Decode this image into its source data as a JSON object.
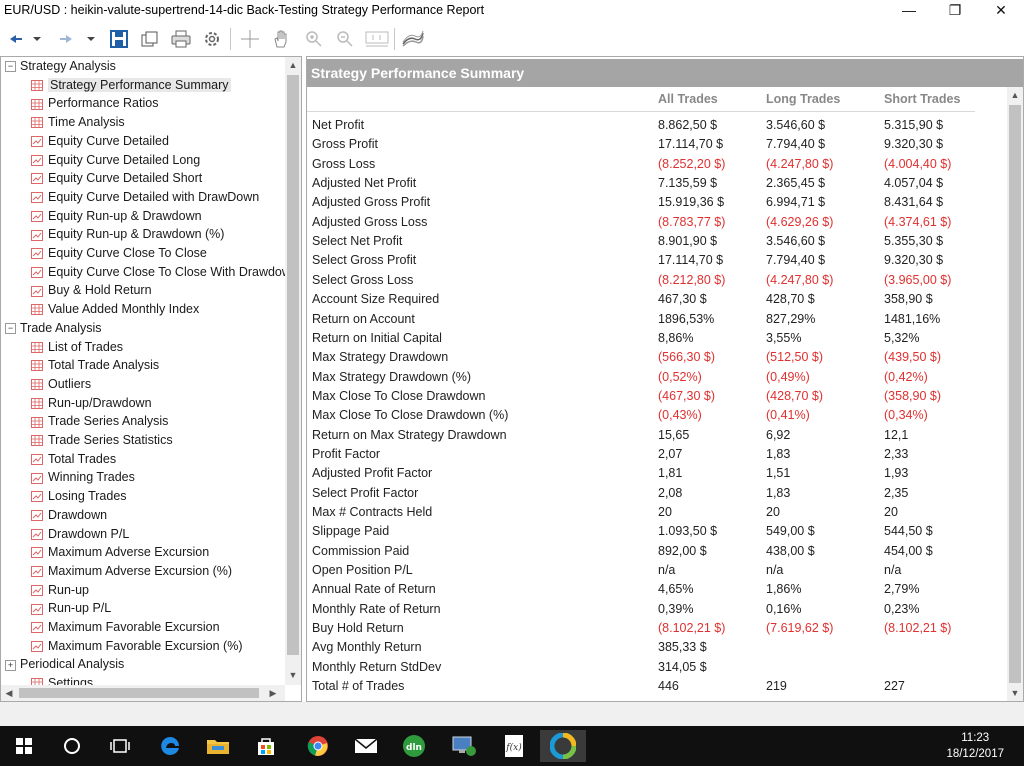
{
  "window": {
    "title": "EUR/USD : heikin-valute-supertrend-14-dic Back-Testing Strategy Performance Report",
    "minimize": "—",
    "restore": "❐",
    "close": "✕"
  },
  "toolbar": {
    "buttons": [
      "back-icon",
      "forward-icon",
      "save-icon",
      "copy-icon",
      "print-icon",
      "settings-icon",
      "crosshair-icon",
      "hand-icon",
      "zoom-in-icon",
      "zoom-out-icon",
      "zoom-fit-icon",
      "chart-style-icon"
    ]
  },
  "tree": {
    "groups": [
      {
        "label": "Strategy Analysis",
        "expanded": true,
        "items": [
          {
            "label": "Strategy Performance Summary",
            "icon": "table",
            "selected": true
          },
          {
            "label": "Performance Ratios",
            "icon": "table"
          },
          {
            "label": "Time Analysis",
            "icon": "table"
          },
          {
            "label": "Equity Curve Detailed",
            "icon": "chart"
          },
          {
            "label": "Equity Curve Detailed Long",
            "icon": "chart"
          },
          {
            "label": "Equity Curve Detailed Short",
            "icon": "chart"
          },
          {
            "label": "Equity Curve Detailed with DrawDown",
            "icon": "chart"
          },
          {
            "label": "Equity Run-up & Drawdown",
            "icon": "chart"
          },
          {
            "label": "Equity Run-up & Drawdown (%)",
            "icon": "chart"
          },
          {
            "label": "Equity Curve Close To Close",
            "icon": "chart"
          },
          {
            "label": "Equity Curve Close To Close With Drawdown",
            "icon": "chart"
          },
          {
            "label": "Buy & Hold Return",
            "icon": "chart"
          },
          {
            "label": "Value Added Monthly Index",
            "icon": "table"
          }
        ]
      },
      {
        "label": "Trade Analysis",
        "expanded": true,
        "items": [
          {
            "label": "List of Trades",
            "icon": "table"
          },
          {
            "label": "Total Trade Analysis",
            "icon": "table"
          },
          {
            "label": "Outliers",
            "icon": "table"
          },
          {
            "label": "Run-up/Drawdown",
            "icon": "table"
          },
          {
            "label": "Trade Series Analysis",
            "icon": "table"
          },
          {
            "label": "Trade Series Statistics",
            "icon": "table"
          },
          {
            "label": "Total Trades",
            "icon": "chart"
          },
          {
            "label": "Winning Trades",
            "icon": "chart"
          },
          {
            "label": "Losing Trades",
            "icon": "chart"
          },
          {
            "label": "Drawdown",
            "icon": "chart"
          },
          {
            "label": "Drawdown P/L",
            "icon": "chart"
          },
          {
            "label": "Maximum Adverse Excursion",
            "icon": "chart"
          },
          {
            "label": "Maximum Adverse Excursion (%)",
            "icon": "chart"
          },
          {
            "label": "Run-up",
            "icon": "chart"
          },
          {
            "label": "Run-up P/L",
            "icon": "chart"
          },
          {
            "label": "Maximum Favorable Excursion",
            "icon": "chart"
          },
          {
            "label": "Maximum Favorable Excursion (%)",
            "icon": "chart"
          }
        ]
      },
      {
        "label": "Periodical Analysis",
        "expanded": false,
        "items": []
      }
    ],
    "partial_item": "Settings"
  },
  "report": {
    "header": "Strategy Performance Summary",
    "columns": [
      "All Trades",
      "Long Trades",
      "Short Trades"
    ],
    "rows": [
      {
        "label": "Net Profit",
        "all": "8.862,50 $",
        "long": "3.546,60 $",
        "short": "5.315,90 $",
        "neg": false
      },
      {
        "label": "Gross Profit",
        "all": "17.114,70 $",
        "long": "7.794,40 $",
        "short": "9.320,30 $",
        "neg": false
      },
      {
        "label": "Gross Loss",
        "all": "(8.252,20 $)",
        "long": "(4.247,80 $)",
        "short": "(4.004,40 $)",
        "neg": true
      },
      {
        "label": "Adjusted Net Profit",
        "all": "7.135,59 $",
        "long": "2.365,45 $",
        "short": "4.057,04 $",
        "neg": false
      },
      {
        "label": "Adjusted Gross Profit",
        "all": "15.919,36 $",
        "long": "6.994,71 $",
        "short": "8.431,64 $",
        "neg": false
      },
      {
        "label": "Adjusted Gross Loss",
        "all": "(8.783,77 $)",
        "long": "(4.629,26 $)",
        "short": "(4.374,61 $)",
        "neg": true
      },
      {
        "label": "Select Net Profit",
        "all": "8.901,90 $",
        "long": "3.546,60 $",
        "short": "5.355,30 $",
        "neg": false
      },
      {
        "label": "Select Gross Profit",
        "all": "17.114,70 $",
        "long": "7.794,40 $",
        "short": "9.320,30 $",
        "neg": false
      },
      {
        "label": "Select Gross Loss",
        "all": "(8.212,80 $)",
        "long": "(4.247,80 $)",
        "short": "(3.965,00 $)",
        "neg": true
      },
      {
        "label": "Account Size Required",
        "all": "467,30 $",
        "long": "428,70 $",
        "short": "358,90 $",
        "neg": false
      },
      {
        "label": "Return on Account",
        "all": "1896,53%",
        "long": "827,29%",
        "short": "1481,16%",
        "neg": false
      },
      {
        "label": "Return on Initial Capital",
        "all": "8,86%",
        "long": "3,55%",
        "short": "5,32%",
        "neg": false
      },
      {
        "label": "Max Strategy Drawdown",
        "all": "(566,30 $)",
        "long": "(512,50 $)",
        "short": "(439,50 $)",
        "neg": true
      },
      {
        "label": "Max Strategy Drawdown (%)",
        "all": "(0,52%)",
        "long": "(0,49%)",
        "short": "(0,42%)",
        "neg": true
      },
      {
        "label": "Max Close To Close Drawdown",
        "all": "(467,30 $)",
        "long": "(428,70 $)",
        "short": "(358,90 $)",
        "neg": true
      },
      {
        "label": "Max Close To Close Drawdown (%)",
        "all": "(0,43%)",
        "long": "(0,41%)",
        "short": "(0,34%)",
        "neg": true
      },
      {
        "label": "Return on Max Strategy Drawdown",
        "all": "15,65",
        "long": "6,92",
        "short": "12,1",
        "neg": false
      },
      {
        "label": "Profit Factor",
        "all": "2,07",
        "long": "1,83",
        "short": "2,33",
        "neg": false
      },
      {
        "label": "Adjusted Profit Factor",
        "all": "1,81",
        "long": "1,51",
        "short": "1,93",
        "neg": false
      },
      {
        "label": "Select Profit Factor",
        "all": "2,08",
        "long": "1,83",
        "short": "2,35",
        "neg": false
      },
      {
        "label": "Max # Contracts Held",
        "all": "20",
        "long": "20",
        "short": "20",
        "neg": false
      },
      {
        "label": "Slippage Paid",
        "all": "1.093,50 $",
        "long": "549,00 $",
        "short": "544,50 $",
        "neg": false
      },
      {
        "label": "Commission Paid",
        "all": "892,00 $",
        "long": "438,00 $",
        "short": "454,00 $",
        "neg": false
      },
      {
        "label": "Open Position P/L",
        "all": "n/a",
        "long": "n/a",
        "short": "n/a",
        "neg": false
      },
      {
        "label": "Annual Rate of Return",
        "all": "4,65%",
        "long": "1,86%",
        "short": "2,79%",
        "neg": false
      },
      {
        "label": "Monthly Rate of Return",
        "all": "0,39%",
        "long": "0,16%",
        "short": "0,23%",
        "neg": false
      },
      {
        "label": "Buy  Hold Return",
        "all": "(8.102,21 $)",
        "long": "(7.619,62 $)",
        "short": "(8.102,21 $)",
        "neg": true
      },
      {
        "label": "Avg Monthly Return",
        "all": "385,33 $",
        "long": "",
        "short": "",
        "neg": false
      },
      {
        "label": "Monthly Return StdDev",
        "all": "314,05 $",
        "long": "",
        "short": "",
        "neg": false
      },
      {
        "label": "Total # of Trades",
        "all": "446",
        "long": "219",
        "short": "227",
        "neg": false
      }
    ]
  },
  "taskbar": {
    "apps": [
      "windows-start-icon",
      "cortana-icon",
      "task-view-icon",
      "edge-icon",
      "file-explorer-icon",
      "store-icon",
      "chrome-icon",
      "mail-icon",
      "dln-app-icon",
      "network-app-icon",
      "fx-app-icon",
      "trading-app-icon"
    ],
    "active_app": "trading-app-icon",
    "time": "11:23",
    "date": "18/12/2017"
  },
  "colors": {
    "negative": "#e03030",
    "panel_header": "#a5a5a5",
    "column_header": "#888888"
  }
}
